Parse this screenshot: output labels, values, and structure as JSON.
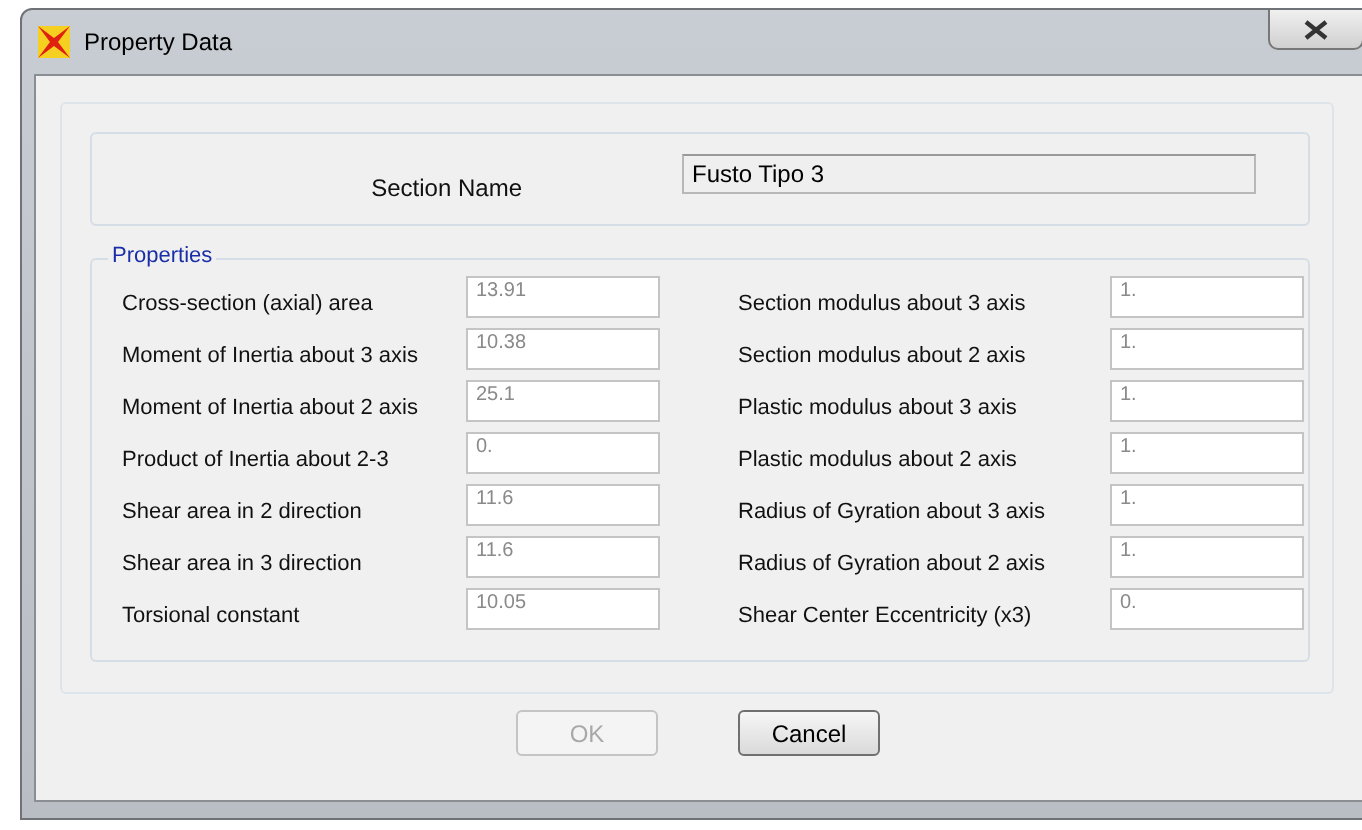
{
  "window": {
    "title": "Property Data"
  },
  "section_name": {
    "label": "Section Name",
    "value": "Fusto Tipo 3"
  },
  "properties": {
    "title": "Properties",
    "left": [
      {
        "label": "Cross-section (axial) area",
        "value": "13.91",
        "disabled": true
      },
      {
        "label": "Moment of Inertia about 3 axis",
        "value": "10.38",
        "disabled": true
      },
      {
        "label": "Moment of Inertia about 2 axis",
        "value": "25.1",
        "disabled": true
      },
      {
        "label": "Product of Inertia about 2-3",
        "value": "0.",
        "disabled": true
      },
      {
        "label": "Shear area in 2 direction",
        "value": "11.6",
        "disabled": true
      },
      {
        "label": "Shear area in 3 direction",
        "value": "11.6",
        "disabled": true
      },
      {
        "label": "Torsional constant",
        "value": "10.05",
        "disabled": true
      }
    ],
    "right": [
      {
        "label": "Section modulus about 3 axis",
        "value": "1.",
        "disabled": true
      },
      {
        "label": "Section modulus about 2 axis",
        "value": "1.",
        "disabled": true
      },
      {
        "label": "Plastic modulus about 3 axis",
        "value": "1.",
        "disabled": true
      },
      {
        "label": "Plastic modulus about 2 axis",
        "value": "1.",
        "disabled": true
      },
      {
        "label": "Radius of Gyration about 3 axis",
        "value": "1.",
        "disabled": true
      },
      {
        "label": "Radius of Gyration about 2 axis",
        "value": "1.",
        "disabled": true
      },
      {
        "label": "Shear Center Eccentricity (x3)",
        "value": "0.",
        "disabled": true
      }
    ]
  },
  "buttons": [
    {
      "label": "OK",
      "disabled": true
    },
    {
      "label": "Cancel",
      "disabled": false
    }
  ]
}
